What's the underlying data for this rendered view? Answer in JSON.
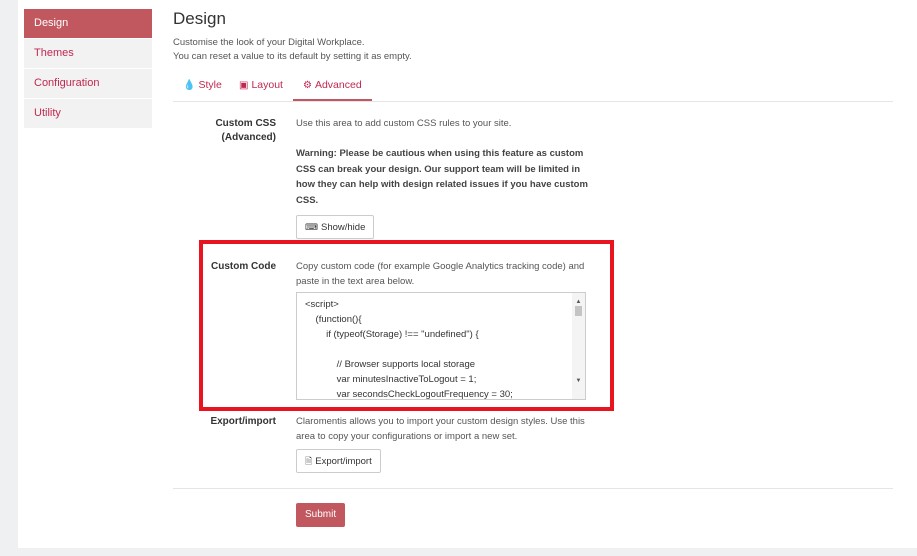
{
  "sidebar": {
    "items": [
      {
        "label": "Design"
      },
      {
        "label": "Themes"
      },
      {
        "label": "Configuration"
      },
      {
        "label": "Utility"
      }
    ]
  },
  "header": {
    "title": "Design",
    "subtitle_line1": "Customise the look of your Digital Workplace.",
    "subtitle_line2": "You can reset a value to its default by setting it as empty."
  },
  "tabs": [
    {
      "label": "Style",
      "icon": "paint-drops-icon"
    },
    {
      "label": "Layout",
      "icon": "layout-icon"
    },
    {
      "label": "Advanced",
      "icon": "gear-icon"
    }
  ],
  "custom_css": {
    "label_line1": "Custom CSS",
    "label_line2": "(Advanced)",
    "description": "Use this area to add custom CSS rules to your site.",
    "warning": "Warning: Please be cautious when using this feature as custom CSS can break your design. Our support team will be limited in how they can help with design related issues if you have custom CSS.",
    "show_hide_label": "Show/hide"
  },
  "custom_code": {
    "label": "Custom Code",
    "description": "Copy custom code (for example Google Analytics tracking code) and paste in the text area below.",
    "code": "<script>\n    (function(){\n        if (typeof(Storage) !== \"undefined\") {\n\n            // Browser supports local storage\n            var minutesInactiveToLogout = 1;\n            var secondsCheckLogoutFrequency = 30;"
  },
  "export_import": {
    "label": "Export/import",
    "description": "Claromentis allows you to import your custom design styles. Use this area to copy your configurations or import a new set.",
    "button_label": "Export/import"
  },
  "submit_label": "Submit",
  "colors": {
    "accent": "#c1585f",
    "link": "#c0284f",
    "highlight": "#e8141f"
  }
}
